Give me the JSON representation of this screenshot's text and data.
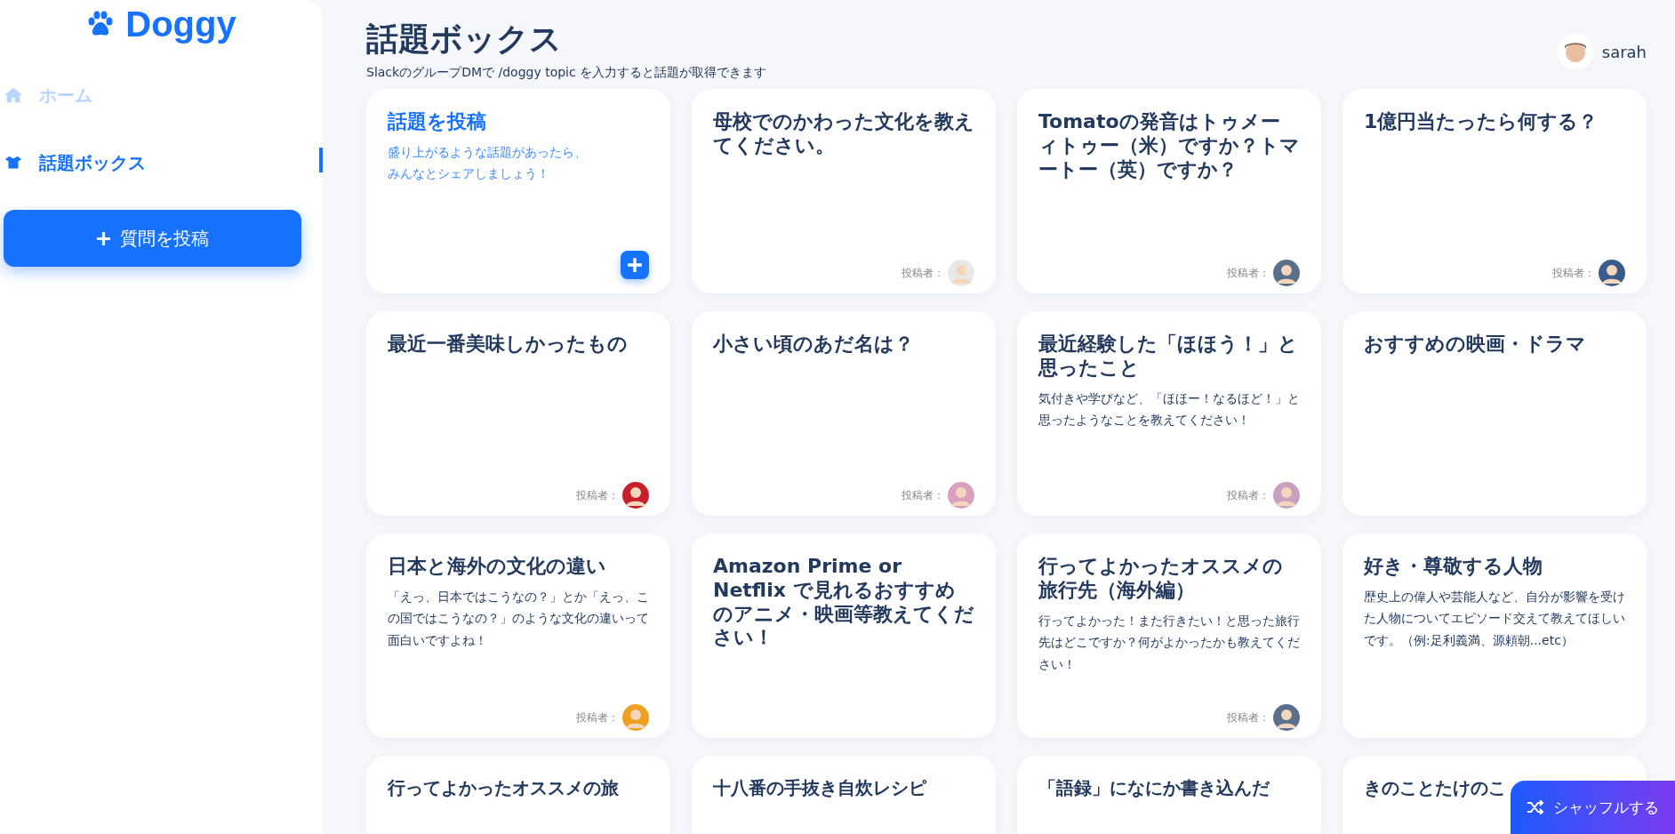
{
  "brand": {
    "name": "Doggy"
  },
  "nav": [
    {
      "label": "ホーム",
      "selected": false
    },
    {
      "label": "話題ボックス",
      "selected": true
    }
  ],
  "post_question_button": {
    "label": "質問を投稿"
  },
  "header": {
    "title": "話題ボックス",
    "subtitle": "SlackのグループDMで /doggy topic を入力すると話題が取得できます"
  },
  "user": {
    "name": "sarah"
  },
  "cards": [
    {
      "kind": "new",
      "title": "話題を投稿",
      "description": "盛り上がるような話題があったら、みんなとシェアしましょう！"
    },
    {
      "kind": "topic",
      "title": "母校でのかわった文化を教えてください。",
      "author_label": "投稿者："
    },
    {
      "kind": "topic",
      "title": "Tomatoの発音はトゥメーィトゥー（米）ですか？トマートー（英）ですか？",
      "author_label": "投稿者："
    },
    {
      "kind": "topic",
      "title": "1億円当たったら何する？",
      "author_label": "投稿者："
    },
    {
      "kind": "topic",
      "title": "最近一番美味しかったもの",
      "author_label": "投稿者："
    },
    {
      "kind": "topic",
      "title": "小さい頃のあだ名は？",
      "author_label": "投稿者："
    },
    {
      "kind": "topic",
      "title": "最近経験した「ほほう！」と思ったこと",
      "description": "気付きや学びなど、「ほほー！なるほど！」と思ったようなことを教えてください！",
      "author_label": "投稿者："
    },
    {
      "kind": "topic",
      "title": "おすすめの映画・ドラマ"
    },
    {
      "kind": "topic",
      "title": "日本と海外の文化の違い",
      "description": "「えっ、日本ではこうなの？」とか「えっ、この国ではこうなの？」のような文化の違いって面白いですよね！",
      "author_label": "投稿者："
    },
    {
      "kind": "topic",
      "title": "Amazon Prime or Netflix で見れるおすすめのアニメ・映画等教えてください！"
    },
    {
      "kind": "topic",
      "title": "行ってよかったオススメの旅行先（海外編）",
      "description": "行ってよかった！また行きたい！と思った旅行先はどこですか？何がよかったかも教えてください！",
      "author_label": "投稿者："
    },
    {
      "kind": "topic",
      "title": "好き・尊敬する人物",
      "description": "歴史上の偉人や芸能人など、自分が影響を受けた人物についてエピソード交えて教えてほしいです。（例:足利義満、源頼朝...etc）"
    },
    {
      "kind": "topic",
      "title": "行ってよかったオススメの旅"
    },
    {
      "kind": "topic",
      "title": "十八番の手抜き自炊レシピ"
    },
    {
      "kind": "topic",
      "title": "「語録」になにか書き込んだ"
    },
    {
      "kind": "topic",
      "title": "きのことたけのこ"
    }
  ],
  "shuffle_button": {
    "label": "シャッフルする"
  }
}
